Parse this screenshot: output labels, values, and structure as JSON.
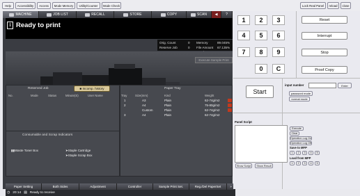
{
  "topbar": {
    "left_buttons": [
      "Help",
      "Accessibility",
      "Access",
      "Mode Memory",
      "Utility/Counter",
      "Mode Check"
    ],
    "right_buttons": [
      "Lock Real Panel",
      "reload",
      "close"
    ]
  },
  "tabs": [
    "MACHINE",
    "JOB LIST",
    "RECALL",
    "STORE",
    "COPY",
    "SCAN"
  ],
  "status": {
    "message": "Ready to print",
    "scanner": "Ready to use scanner",
    "execute_sample": "Execute Sample Print"
  },
  "counts": {
    "orig_label": "Orig. Count",
    "orig_value": "0",
    "memory_label": "Memory",
    "memory_value": "89.045%",
    "reserve_label": "Reserve Job",
    "reserve_value": "0",
    "file_label": "File Amount",
    "file_value": "67.135%"
  },
  "reserved": {
    "title": "Reserved Job",
    "history_btn": "Incomp. history",
    "headers": [
      "No.",
      "Mode",
      "Status",
      "Minute(S)",
      "User Name"
    ]
  },
  "tray": {
    "title": "Paper Tray",
    "headers": [
      "Tray",
      "Size(mm)",
      "Kind",
      "Weight"
    ],
    "rows": [
      {
        "tray": "1",
        "size": "A3",
        "kind": "Plain",
        "weight": "62-74g/m2"
      },
      {
        "tray": "2",
        "size": "A4",
        "kind": "Plain",
        "weight": "75-80g/m2"
      },
      {
        "tray": "",
        "size": "Custom",
        "kind": "Plain",
        "weight": "62-74g/m2"
      },
      {
        "tray": "3",
        "size": "A4",
        "kind": "Plain",
        "weight": "62-74g/m2"
      }
    ]
  },
  "consumable": {
    "title": "Consumable and Scrap Indicators",
    "waste": "Waste Toner Box",
    "staple_cart": "Staple Cartridge",
    "staple_box": "Staple Scrap Box"
  },
  "bottom_tabs": [
    "Paper Setting",
    "Both Sides",
    "Adjustment",
    "Controller",
    "Sample Print Set.",
    "Reg./Del PaperSet"
  ],
  "statusbar": {
    "time": "20:14",
    "message": "Ready to receive"
  },
  "keypad": {
    "keys": [
      "1",
      "2",
      "3",
      "4",
      "5",
      "6",
      "7",
      "8",
      "9",
      "0",
      "C"
    ],
    "reset": "Reset",
    "interrupt": "Interrupt",
    "stop": "Stop",
    "proof": "Proof Copy",
    "start": "Start"
  },
  "input": {
    "label": "input number",
    "enter": "Enter",
    "password": "password mode",
    "normal": "normal mode"
  },
  "panel_script": {
    "label": "Panel Script",
    "show_script": "Show Script",
    "show_result": "Show Result",
    "execute": "Execute",
    "clear": "Clear",
    "log_on": "Operation Log On",
    "log_off": "Operation Log Off",
    "save_label": "Save to MFP",
    "load_label": "Load from MFP",
    "slots": [
      "1",
      "2",
      "3",
      "4",
      "5"
    ]
  }
}
